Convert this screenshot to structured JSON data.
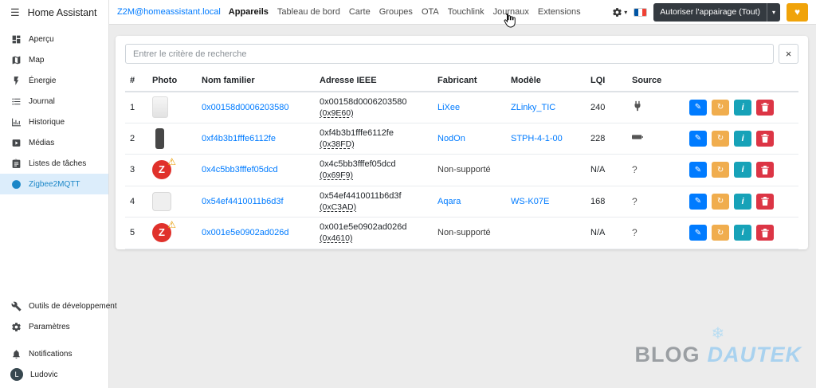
{
  "sidebar": {
    "title": "Home Assistant",
    "items": [
      {
        "label": "Aperçu"
      },
      {
        "label": "Map"
      },
      {
        "label": "Énergie"
      },
      {
        "label": "Journal"
      },
      {
        "label": "Historique"
      },
      {
        "label": "Médias"
      },
      {
        "label": "Listes de tâches"
      },
      {
        "label": "Zigbee2MQTT"
      }
    ],
    "dev_items": [
      {
        "label": "Outils de développement"
      },
      {
        "label": "Paramètres"
      }
    ],
    "footer_items": [
      {
        "label": "Notifications"
      },
      {
        "label": "Ludovic",
        "avatar_letter": "L"
      }
    ]
  },
  "topbar": {
    "host_link": "Z2M@homeassistant.local",
    "nav": [
      "Appareils",
      "Tableau de bord",
      "Carte",
      "Groupes",
      "OTA",
      "Touchlink",
      "Journaux",
      "Extensions"
    ],
    "permit_join": "Autoriser l'appairage (Tout)"
  },
  "search": {
    "placeholder": "Entrer le critère de recherche"
  },
  "table": {
    "headers": {
      "num": "#",
      "photo": "Photo",
      "name": "Nom familier",
      "ieee": "Adresse IEEE",
      "manufacturer": "Fabricant",
      "model": "Modèle",
      "lqi": "LQI",
      "source": "Source"
    },
    "rows": [
      {
        "num": "1",
        "name": "0x00158d0006203580",
        "ieee": "0x00158d0006203580",
        "short": "(0x9E60)",
        "manufacturer": "LiXee",
        "model": "ZLinky_TIC",
        "lqi": "240",
        "source": ""
      },
      {
        "num": "2",
        "name": "0xf4b3b1fffe6112fe",
        "ieee": "0xf4b3b1fffe6112fe",
        "short": "(0x38FD)",
        "manufacturer": "NodOn",
        "model": "STPH-4-1-00",
        "lqi": "228",
        "source": ""
      },
      {
        "num": "3",
        "name": "0x4c5bb3fffef05dcd",
        "ieee": "0x4c5bb3fffef05dcd",
        "short": "(0x69F9)",
        "manufacturer": "Non-supporté",
        "model": "",
        "lqi": "N/A",
        "source": "?"
      },
      {
        "num": "4",
        "name": "0x54ef4410011b6d3f",
        "ieee": "0x54ef4410011b6d3f",
        "short": "(0xC3AD)",
        "manufacturer": "Aqara",
        "model": "WS-K07E",
        "lqi": "168",
        "source": "?"
      },
      {
        "num": "5",
        "name": "0x001e5e0902ad026d",
        "ieee": "0x001e5e0902ad026d",
        "short": "(0x4610)",
        "manufacturer": "Non-supporté",
        "model": "",
        "lqi": "N/A",
        "source": "?"
      }
    ],
    "unsupported_logo_letter": "Z"
  },
  "watermark": {
    "brand_gray": "BLOG",
    "brand_blue": "DAUTEK"
  },
  "icons": {
    "menu": "☰",
    "caret": "▾",
    "close": "×",
    "warning": "⚠",
    "pencil": "✎",
    "refresh": "↻",
    "info": "i",
    "heart": "♥",
    "snowflake": "❄"
  },
  "colors": {
    "accent_blue": "#007bff",
    "active_item_bg": "#dcedfb",
    "active_item_text": "#1b86c7",
    "btn_edit": "#007bff",
    "btn_reconfigure": "#f0ad4e",
    "btn_info": "#17a2b8",
    "btn_delete": "#dc3545",
    "permit_btn_bg": "#343a40",
    "donate_btn_bg": "#f0a30a",
    "unsupported_red": "#e0312b"
  }
}
